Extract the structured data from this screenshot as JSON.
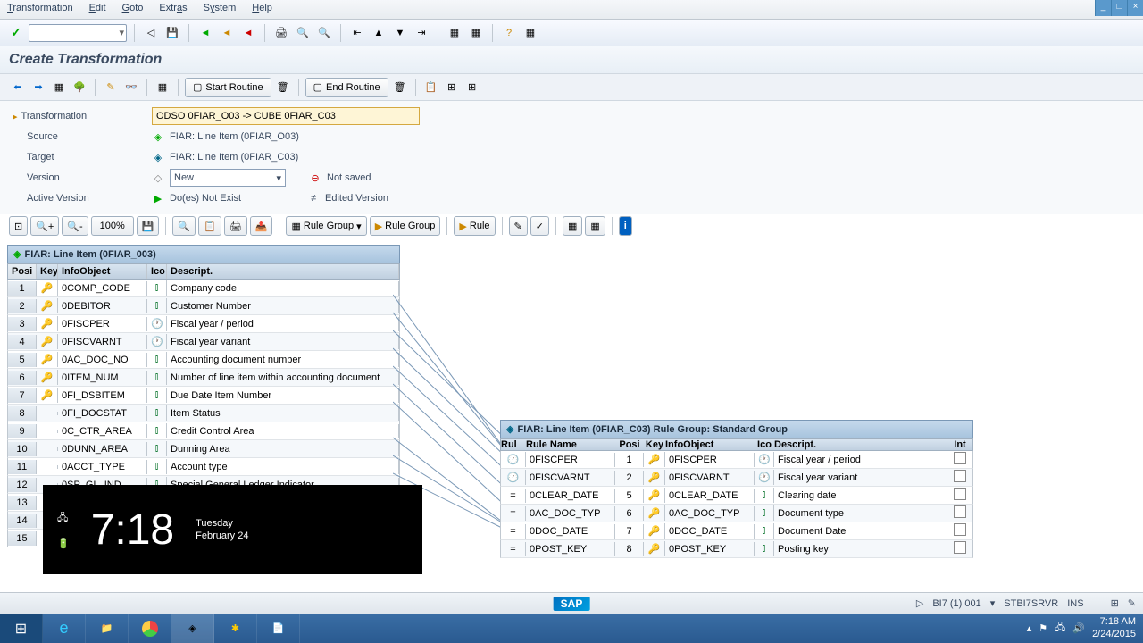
{
  "menu": {
    "items": [
      "Transformation",
      "Edit",
      "Goto",
      "Extras",
      "System",
      "Help"
    ]
  },
  "titlebar": {
    "min": "_",
    "max": "□",
    "close": "×"
  },
  "section_title": "Create Transformation",
  "toolbar2": {
    "start_routine": "Start Routine",
    "end_routine": "End Routine"
  },
  "form": {
    "transformation_label": "Transformation",
    "transformation_value": "ODSO 0FIAR_O03 -> CUBE 0FIAR_C03",
    "source_label": "Source",
    "source_value": "FIAR: Line Item (0FIAR_O03)",
    "target_label": "Target",
    "target_value": "FIAR: Line Item (0FIAR_C03)",
    "version_label": "Version",
    "version_value": "New",
    "not_saved": "Not saved",
    "active_label": "Active Version",
    "active_value": "Do(es) Not Exist",
    "edited": "Edited Version"
  },
  "zoom": {
    "pct": "100%",
    "rule_group": "Rule Group",
    "rule": "Rule"
  },
  "source_panel": {
    "title": "FIAR: Line Item (0FIAR_003)",
    "cols": {
      "pos": "Posi",
      "key": "Key",
      "io": "InfoObject",
      "ico": "Ico",
      "desc": "Descript."
    },
    "rows": [
      {
        "pos": "1",
        "io": "0COMP_CODE",
        "desc": "Company code",
        "key": true,
        "t": "char"
      },
      {
        "pos": "2",
        "io": "0DEBITOR",
        "desc": "Customer Number",
        "key": true,
        "t": "char"
      },
      {
        "pos": "3",
        "io": "0FISCPER",
        "desc": "Fiscal year / period",
        "key": true,
        "t": "time"
      },
      {
        "pos": "4",
        "io": "0FISCVARNT",
        "desc": "Fiscal year variant",
        "key": true,
        "t": "time"
      },
      {
        "pos": "5",
        "io": "0AC_DOC_NO",
        "desc": "Accounting document number",
        "key": true,
        "t": "char"
      },
      {
        "pos": "6",
        "io": "0ITEM_NUM",
        "desc": "Number of line item within accounting document",
        "key": true,
        "t": "char"
      },
      {
        "pos": "7",
        "io": "0FI_DSBITEM",
        "desc": "Due Date Item Number",
        "key": true,
        "t": "char"
      },
      {
        "pos": "8",
        "io": "0FI_DOCSTAT",
        "desc": "Item Status",
        "key": false,
        "t": "char"
      },
      {
        "pos": "9",
        "io": "0C_CTR_AREA",
        "desc": "Credit Control Area",
        "key": false,
        "t": "char"
      },
      {
        "pos": "10",
        "io": "0DUNN_AREA",
        "desc": "Dunning Area",
        "key": false,
        "t": "char"
      },
      {
        "pos": "11",
        "io": "0ACCT_TYPE",
        "desc": "Account type",
        "key": false,
        "t": "char"
      },
      {
        "pos": "12",
        "io": "0SP_GL_IND",
        "desc": "Special General Ledger Indicator",
        "key": false,
        "t": "char"
      },
      {
        "pos": "13",
        "io": "",
        "desc": "",
        "key": false,
        "t": ""
      },
      {
        "pos": "14",
        "io": "",
        "desc": "",
        "key": false,
        "t": ""
      },
      {
        "pos": "15",
        "io": "",
        "desc": "",
        "key": false,
        "t": ""
      }
    ]
  },
  "target_panel": {
    "title": "FIAR: Line Item (0FIAR_C03) Rule Group: Standard Group",
    "cols": {
      "rule": "Rul",
      "rname": "Rule Name",
      "pos": "Posi",
      "key": "Key",
      "io": "InfoObject",
      "ico": "Ico",
      "desc": "Descript.",
      "int": "Int"
    },
    "rows": [
      {
        "rt": "time",
        "rname": "0FISCPER",
        "pos": "1",
        "io": "0FISCPER",
        "desc": "Fiscal year / period"
      },
      {
        "rt": "time",
        "rname": "0FISCVARNT",
        "pos": "2",
        "io": "0FISCVARNT",
        "desc": "Fiscal year variant"
      },
      {
        "rt": "eq",
        "rname": "0CLEAR_DATE",
        "pos": "5",
        "io": "0CLEAR_DATE",
        "desc": "Clearing date"
      },
      {
        "rt": "eq",
        "rname": "0AC_DOC_TYP",
        "pos": "6",
        "io": "0AC_DOC_TYP",
        "desc": "Document type"
      },
      {
        "rt": "eq",
        "rname": "0DOC_DATE",
        "pos": "7",
        "io": "0DOC_DATE",
        "desc": "Document Date"
      },
      {
        "rt": "eq",
        "rname": "0POST_KEY",
        "pos": "8",
        "io": "0POST_KEY",
        "desc": "Posting key"
      }
    ]
  },
  "clock": {
    "time": "7:18",
    "day": "Tuesday",
    "date": "February 24"
  },
  "status": {
    "system": "BI7 (1) 001",
    "server": "STBI7SRVR",
    "mode": "INS"
  },
  "sap": "SAP",
  "tray": {
    "time": "7:18 AM",
    "date": "2/24/2015"
  }
}
